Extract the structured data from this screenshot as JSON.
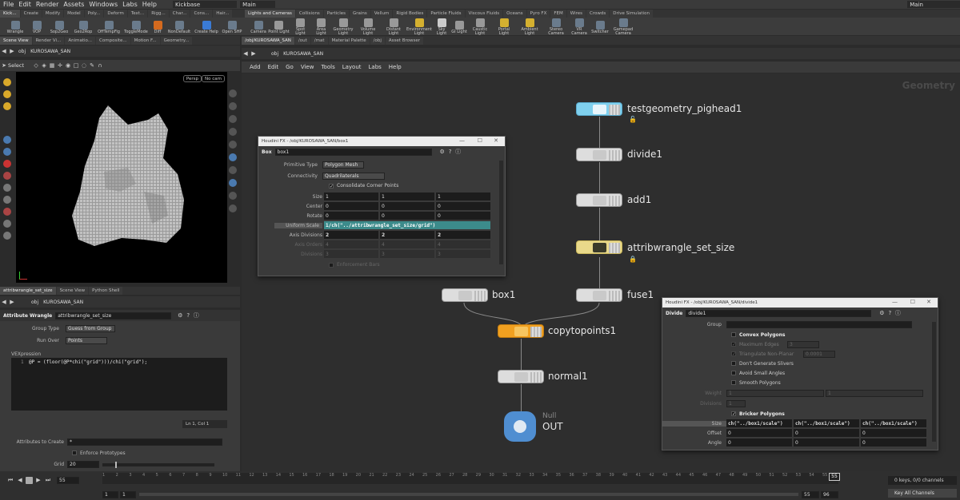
{
  "menu": [
    "File",
    "Edit",
    "Render",
    "Assets",
    "Windows",
    "Labs",
    "Help"
  ],
  "desktop_left": "Kickbase",
  "desktop_right": "Main",
  "desktop_right2": "Main",
  "shelf_tabs_left": [
    "Kick...",
    "Create",
    "Modify",
    "Model",
    "Poly...",
    "Deform",
    "Text...",
    "Rigg...",
    "Char...",
    "Cons...",
    "Hair..."
  ],
  "shelf_tabs_right": [
    "Lights and Cameras",
    "Collisions",
    "Particles",
    "Grains",
    "Vellum",
    "Rigid Bodies",
    "Particle Fluids",
    "Viscous Fluids",
    "Oceans",
    "Pyro FX",
    "FEM",
    "Wires",
    "Crowds",
    "Drive Simulation"
  ],
  "tools_left": [
    "Wrangle",
    "VOP",
    "Sop2Geo",
    "Geo2Rop",
    "OffTempFig",
    "ToggleMode",
    "Diff",
    "NonDefault",
    "Create Help",
    "Open SHP"
  ],
  "tools_right": [
    "Camera",
    "Point Light",
    "Spot Light",
    "Area Light",
    "Geometry Light",
    "Volume Light",
    "Distant Light",
    "Environment Light",
    "Sky Light",
    "GI Light",
    "Caustic Light",
    "Portal Light",
    "Ambient Light",
    "Stereo Camera",
    "VR Camera",
    "Switcher",
    "Gamepad Camera"
  ],
  "pane_tabs_left": [
    "Scene View",
    "Render Vi...",
    "Animatio...",
    "Composite...",
    "Motion F...",
    "Geometry..."
  ],
  "pane_tabs_right": [
    "/obj/KUROSAWA_SAN",
    "/out",
    "/mat",
    "Material Palette",
    "/obj",
    "Asset Browser"
  ],
  "path": {
    "obj": "obj",
    "node": "KUROSAWA_SAN"
  },
  "viewport": {
    "select": "Select",
    "persp": "Persp",
    "cam": "No cam"
  },
  "net_menu": [
    "Add",
    "Edit",
    "Go",
    "View",
    "Tools",
    "Layout",
    "Labs",
    "Help"
  ],
  "net_context": "Geometry",
  "nodes": {
    "testgeo": "testgeometry_pighead1",
    "divide": "divide1",
    "add": "add1",
    "wrangle": "attribwrangle_set_size",
    "fuse": "fuse1",
    "box": "box1",
    "copy": "copytopoints1",
    "normal": "normal1",
    "null_type": "Null",
    "null_name": "OUT"
  },
  "box_win": {
    "title": "Houdini FX - /obj/KUROSAWA_SAN/box1",
    "type": "Box",
    "name": "box1",
    "primitive_type_label": "Primitive Type",
    "primitive_type": "Polygon Mesh",
    "connectivity_label": "Connectivity",
    "connectivity": "Quadrilaterals",
    "consolidate": "Consolidate Corner Points",
    "rows": [
      {
        "label": "Size",
        "v": [
          "1",
          "1",
          "1"
        ]
      },
      {
        "label": "Center",
        "v": [
          "0",
          "0",
          "0"
        ]
      },
      {
        "label": "Rotate",
        "v": [
          "0",
          "0",
          "0"
        ]
      },
      {
        "label": "Uniform Scale",
        "expr": "1/ch(\"../attribwrangle_set_size/grid\")"
      },
      {
        "label": "Axis Divisions",
        "v": [
          "2",
          "2",
          "2"
        ]
      },
      {
        "label": "Axis Orders",
        "v": [
          "4",
          "4",
          "4"
        ]
      },
      {
        "label": "Divisions",
        "v": [
          "3",
          "3",
          "3"
        ]
      }
    ],
    "enforce": "Enforcement Bars"
  },
  "divide_win": {
    "title": "Houdini FX - /obj/KUROSAWA_SAN/divide1",
    "type": "Divide",
    "name": "divide1",
    "group_label": "Group",
    "convex": "Convex Polygons",
    "max_edges_label": "Maximum Edges",
    "max_edges": "3",
    "tri_label": "Triangulate Non-Planar",
    "tri_val": "0.0001",
    "no_slivers": "Don't Generate Slivers",
    "avoid": "Avoid Small Angles",
    "smooth": "Smooth Polygons",
    "weight_label": "Weight",
    "weight_v": [
      "1",
      "1"
    ],
    "div_label": "Divisions",
    "div_v": "1",
    "bricker": "Bricker Polygons",
    "size_label": "Size",
    "size_v": [
      "ch(\"../box1/scale\")",
      "ch(\"../box1/scale\")",
      "ch(\"../box1/scale\")"
    ],
    "offset_label": "Offset",
    "offset_v": [
      "0",
      "0",
      "0"
    ],
    "angle_label": "Angle",
    "angle_v": [
      "0",
      "0",
      "0"
    ]
  },
  "param_tabs": [
    "attribwrangle_set_size",
    "Scene View",
    "Python Shell"
  ],
  "wrangle": {
    "type": "Attribute Wrangle",
    "name": "attribwrangle_set_size",
    "group_type_label": "Group Type",
    "group_type": "Guess from Group",
    "run_over_label": "Run Over",
    "run_over": "Points",
    "vex_label": "VEXpression",
    "line_no": "1",
    "code": "@P = (floor(@P*chi(\"grid\")))/chi(\"grid\");",
    "status": "Ln 1, Col 1",
    "attrs_label": "Attributes to Create",
    "attrs": "*",
    "enforce": "Enforce Prototypes",
    "grid_label": "Grid",
    "grid": "20"
  },
  "timeline": {
    "frame": "55",
    "ticks": [
      "1",
      "2",
      "3",
      "4",
      "5",
      "6",
      "7",
      "8",
      "9",
      "10",
      "11",
      "12",
      "13",
      "14",
      "15",
      "16",
      "17",
      "18",
      "19",
      "20",
      "21",
      "22",
      "23",
      "24",
      "25",
      "26",
      "27",
      "28",
      "29",
      "30",
      "31",
      "32",
      "33",
      "34",
      "35",
      "36",
      "37",
      "38",
      "39",
      "40",
      "41",
      "42",
      "43",
      "44",
      "45",
      "46",
      "47",
      "48",
      "49",
      "50",
      "51",
      "52",
      "53",
      "54",
      "55"
    ],
    "marker": "55",
    "start": "1",
    "start2": "1",
    "end": "55",
    "end2": "96",
    "keys": "0 keys, 0/0 channels",
    "keyall": "Key All Channels"
  }
}
